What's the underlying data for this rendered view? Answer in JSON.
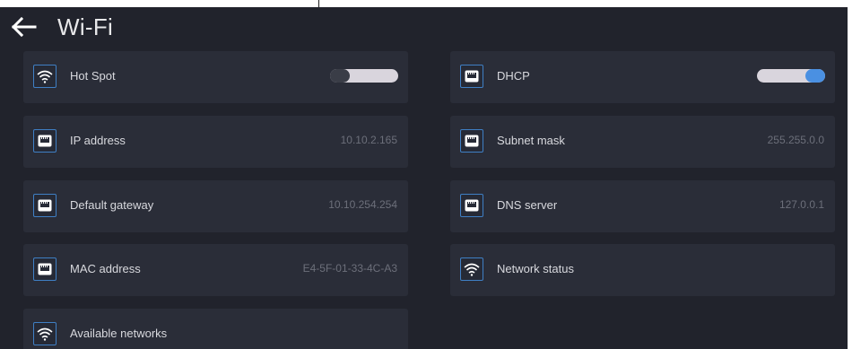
{
  "header": {
    "title": "Wi-Fi"
  },
  "colors": {
    "accent": "#4a90e2",
    "background": "#21232c",
    "tile": "#2a2d38"
  },
  "tiles": {
    "hot_spot": {
      "label": "Hot Spot",
      "icon": "wifi-icon",
      "toggle": "off"
    },
    "dhcp": {
      "label": "DHCP",
      "icon": "ethernet-port-icon",
      "toggle": "on"
    },
    "ip_address": {
      "label": "IP address",
      "value": "10.10.2.165",
      "icon": "ethernet-port-icon"
    },
    "subnet_mask": {
      "label": "Subnet mask",
      "value": "255.255.0.0",
      "icon": "ethernet-port-icon"
    },
    "default_gateway": {
      "label": "Default gateway",
      "value": "10.10.254.254",
      "icon": "ethernet-port-icon"
    },
    "dns_server": {
      "label": "DNS server",
      "value": "127.0.0.1",
      "icon": "ethernet-port-icon"
    },
    "mac_address": {
      "label": "MAC address",
      "value": "E4-5F-01-33-4C-A3",
      "icon": "ethernet-port-icon"
    },
    "network_status": {
      "label": "Network status",
      "icon": "wifi-icon"
    },
    "available_networks": {
      "label": "Available networks",
      "icon": "wifi-icon"
    }
  }
}
